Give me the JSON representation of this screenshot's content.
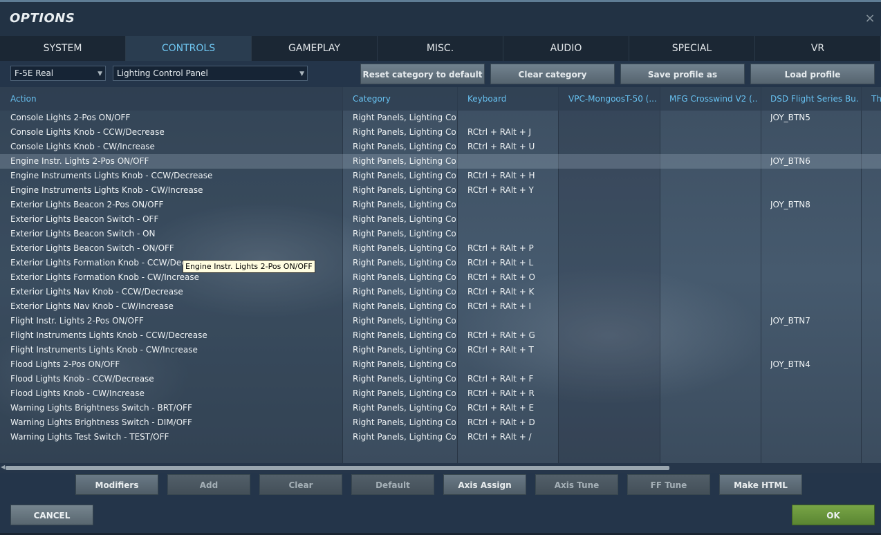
{
  "window": {
    "title": "OPTIONS",
    "close_glyph": "×"
  },
  "tabs": [
    {
      "label": "SYSTEM",
      "active": false
    },
    {
      "label": "CONTROLS",
      "active": true
    },
    {
      "label": "GAMEPLAY",
      "active": false
    },
    {
      "label": "MISC.",
      "active": false
    },
    {
      "label": "AUDIO",
      "active": false
    },
    {
      "label": "SPECIAL",
      "active": false
    },
    {
      "label": "VR",
      "active": false
    }
  ],
  "toolbar": {
    "aircraft_select": "F-5E Real",
    "category_select": "Lighting Control Panel",
    "reset_label": "Reset category to default",
    "clear_category_label": "Clear category",
    "save_profile_label": "Save profile as",
    "load_profile_label": "Load profile"
  },
  "table": {
    "headers": [
      "Action",
      "Category",
      "Keyboard",
      "VPC-MongoosT-50 (...",
      "MFG Crosswind V2 (...",
      "DSD Flight Series Bu...",
      "Th"
    ],
    "rows": [
      {
        "action": "Console Lights 2-Pos ON/OFF",
        "category": "Right Panels, Lighting Con",
        "keyboard": "",
        "joy": "JOY_BTN5"
      },
      {
        "action": "Console Lights Knob - CCW/Decrease",
        "category": "Right Panels, Lighting Con",
        "keyboard": "RCtrl + RAlt + J",
        "joy": ""
      },
      {
        "action": "Console Lights Knob - CW/Increase",
        "category": "Right Panels, Lighting Con",
        "keyboard": "RCtrl + RAlt + U",
        "joy": ""
      },
      {
        "action": "Engine Instr. Lights 2-Pos ON/OFF",
        "category": "Right Panels, Lighting Con",
        "keyboard": "",
        "joy": "JOY_BTN6"
      },
      {
        "action": "Engine Instruments Lights Knob - CCW/Decrease",
        "category": "Right Panels, Lighting Con",
        "keyboard": "RCtrl + RAlt + H",
        "joy": ""
      },
      {
        "action": "Engine Instruments Lights Knob - CW/Increase",
        "category": "Right Panels, Lighting Con",
        "keyboard": "RCtrl + RAlt + Y",
        "joy": ""
      },
      {
        "action": "Exterior Lights Beacon 2-Pos ON/OFF",
        "category": "Right Panels, Lighting Con",
        "keyboard": "",
        "joy": "JOY_BTN8"
      },
      {
        "action": "Exterior Lights Beacon Switch - OFF",
        "category": "Right Panels, Lighting Con",
        "keyboard": "",
        "joy": ""
      },
      {
        "action": "Exterior Lights Beacon Switch - ON",
        "category": "Right Panels, Lighting Con",
        "keyboard": "",
        "joy": ""
      },
      {
        "action": "Exterior Lights Beacon Switch - ON/OFF",
        "category": "Right Panels, Lighting Con",
        "keyboard": "RCtrl + RAlt + P",
        "joy": ""
      },
      {
        "action": "Exterior Lights Formation Knob - CCW/Decrease",
        "category": "Right Panels, Lighting Con",
        "keyboard": "RCtrl + RAlt + L",
        "joy": ""
      },
      {
        "action": "Exterior Lights Formation Knob - CW/Increase",
        "category": "Right Panels, Lighting Con",
        "keyboard": "RCtrl + RAlt + O",
        "joy": ""
      },
      {
        "action": "Exterior Lights Nav Knob - CCW/Decrease",
        "category": "Right Panels, Lighting Con",
        "keyboard": "RCtrl + RAlt + K",
        "joy": ""
      },
      {
        "action": "Exterior Lights Nav Knob - CW/Increase",
        "category": "Right Panels, Lighting Con",
        "keyboard": "RCtrl + RAlt + I",
        "joy": ""
      },
      {
        "action": "Flight Instr. Lights 2-Pos ON/OFF",
        "category": "Right Panels, Lighting Con",
        "keyboard": "",
        "joy": "JOY_BTN7"
      },
      {
        "action": "Flight Instruments Lights Knob - CCW/Decrease",
        "category": "Right Panels, Lighting Con",
        "keyboard": "RCtrl + RAlt + G",
        "joy": ""
      },
      {
        "action": "Flight Instruments Lights Knob - CW/Increase",
        "category": "Right Panels, Lighting Con",
        "keyboard": "RCtrl + RAlt + T",
        "joy": ""
      },
      {
        "action": "Flood Lights 2-Pos ON/OFF",
        "category": "Right Panels, Lighting Con",
        "keyboard": "",
        "joy": "JOY_BTN4"
      },
      {
        "action": "Flood Lights Knob - CCW/Decrease",
        "category": "Right Panels, Lighting Con",
        "keyboard": "RCtrl + RAlt + F",
        "joy": ""
      },
      {
        "action": "Flood Lights Knob - CW/Increase",
        "category": "Right Panels, Lighting Con",
        "keyboard": "RCtrl + RAlt + R",
        "joy": ""
      },
      {
        "action": "Warning Lights Brightness Switch - BRT/OFF",
        "category": "Right Panels, Lighting Con",
        "keyboard": "RCtrl + RAlt + E",
        "joy": ""
      },
      {
        "action": "Warning Lights Brightness Switch - DIM/OFF",
        "category": "Right Panels, Lighting Con",
        "keyboard": "RCtrl + RAlt + D",
        "joy": ""
      },
      {
        "action": "Warning Lights Test Switch - TEST/OFF",
        "category": "Right Panels, Lighting Con",
        "keyboard": "RCtrl + RAlt + /",
        "joy": ""
      }
    ],
    "tooltip": "Engine Instr. Lights 2-Pos ON/OFF"
  },
  "bottom_buttons": [
    {
      "label": "Modifiers",
      "enabled": true
    },
    {
      "label": "Add",
      "enabled": false
    },
    {
      "label": "Clear",
      "enabled": false
    },
    {
      "label": "Default",
      "enabled": false
    },
    {
      "label": "Axis Assign",
      "enabled": true
    },
    {
      "label": "Axis Tune",
      "enabled": false
    },
    {
      "label": "FF Tune",
      "enabled": false
    },
    {
      "label": "Make HTML",
      "enabled": true
    }
  ],
  "footer": {
    "cancel_label": "CANCEL",
    "ok_label": "OK"
  },
  "colors": {
    "accent": "#6fc7f2",
    "ok_green": "#6a9a3c",
    "panel": "#24354a"
  }
}
